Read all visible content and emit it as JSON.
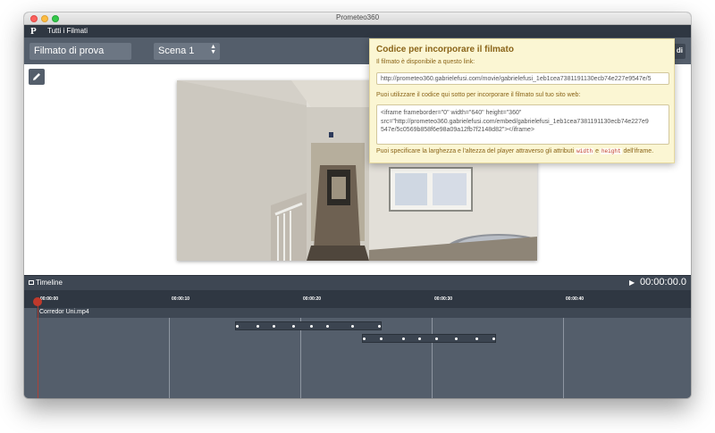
{
  "window": {
    "title": "Prometeo360"
  },
  "menu": {
    "logo": "P",
    "all_videos": "Tutti i Filmati"
  },
  "toolbar": {
    "title_value": "Filmato di prova",
    "scene_value": "Scena 1",
    "right_button_label": "di"
  },
  "icons": {
    "edit": "pencil-icon",
    "timeline": "film-icon",
    "play": "play-icon",
    "scene_arrows": "up-down-arrows-icon"
  },
  "timeline": {
    "label": "Timeline",
    "play_symbol": "▶",
    "timecode": "00:00:00.0",
    "ticks": [
      "00:00:00",
      "00:00:10",
      "00:00:20",
      "00:00:30",
      "00:00:40"
    ],
    "media_file": "Corredor Uni.mp4",
    "playhead_color": "#c0392b"
  },
  "embed_popover": {
    "title": "Codice per incorporare il filmato",
    "available_text": "Il filmato è disponibile a questo link:",
    "url": "http://prometeo360.gabrielefusi.com/movie/gabrielefusi_1eb1cea7381191130ecb74e227e9547e/5",
    "code_intro": "Puoi utilizzare il codice qui sotto per incorporare il filmato sul tuo sito web:",
    "code_line1": "<iframe frameborder=\"0\" width=\"640\" height=\"360\"",
    "code_line2": "src=\"http://prometeo360.gabrielefusi.com/embed/gabrielefusi_1eb1cea7381191130ecb74e227e9",
    "code_line3": "547e/5c0569b858f6e98a09a12fb7f2148d82\"></iframe>",
    "size_note_prefix": "Puoi specificare la larghezza e l'altezza del player attraverso gli attributi",
    "attr_width": "width",
    "conj": "e",
    "attr_height": "height",
    "size_note_suffix": "dell'iframe."
  },
  "colors": {
    "window_bg": "#545e6b",
    "dark_bar": "#2f3742",
    "popover_bg": "#fbf6d3",
    "popover_text": "#8a6418"
  }
}
